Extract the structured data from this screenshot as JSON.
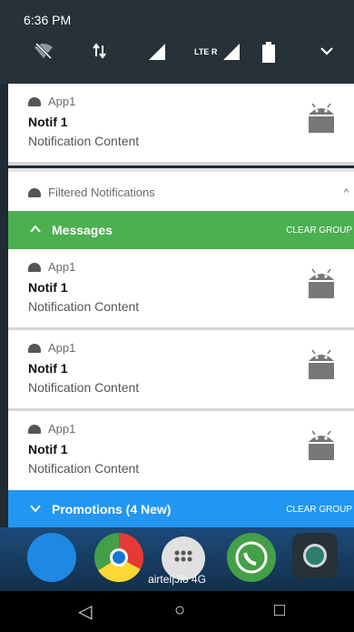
{
  "status_bar": {
    "time": "6:36 PM",
    "quick_settings": [
      {
        "icon": "wifi-off-icon"
      },
      {
        "icon": "data-arrows-icon"
      },
      {
        "icon": "signal-icon"
      },
      {
        "icon": "lte-signal-icon",
        "label": "LTE R"
      },
      {
        "icon": "battery-icon"
      },
      {
        "icon": "chevron-down-icon"
      }
    ]
  },
  "notifications_top": {
    "app": "App1",
    "title": "Notif 1",
    "content": "Notification Content",
    "icon": "android-icon"
  },
  "filtered_header": {
    "label": "Filtered Notifications",
    "chevron": "^"
  },
  "messages_group": {
    "chevron": "^",
    "label": "Messages",
    "clear": "CLEAR GROUP",
    "color": "#4caf50",
    "items": [
      {
        "app": "App1",
        "title": "Notif 1",
        "content": "Notification Content"
      },
      {
        "app": "App1",
        "title": "Notif 1",
        "content": "Notification Content"
      },
      {
        "app": "App1",
        "title": "Notif 1",
        "content": "Notification Content"
      }
    ]
  },
  "promotions_group": {
    "chevron": "v",
    "label": "Promotions (4 New)",
    "clear": "CLEAR GROUP",
    "color": "#2196f3"
  },
  "home": {
    "carrier": "airtel|Jio 4G",
    "apps": [
      "phone-icon",
      "chrome-icon",
      "app-drawer-icon",
      "whatsapp-icon",
      "camera-icon"
    ]
  },
  "nav": {
    "back": "◁",
    "home": "○",
    "recents": "□"
  }
}
